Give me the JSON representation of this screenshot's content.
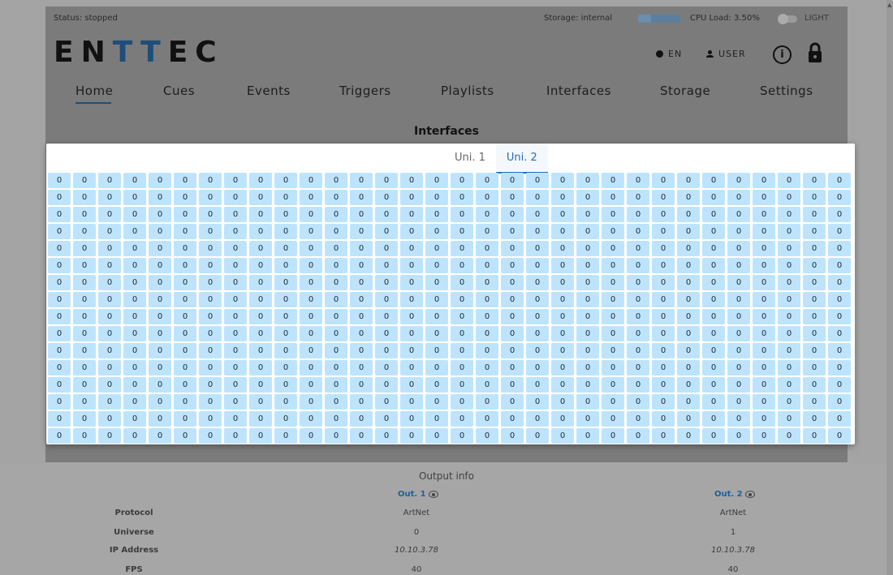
{
  "status": {
    "text": "Status: stopped"
  },
  "storage": {
    "label": "Storage: internal",
    "fill_fraction": 0.3
  },
  "cpu": {
    "label": "CPU Load: 3.50%"
  },
  "theme": {
    "label": "LIGHT"
  },
  "logo": {
    "part1": "EN",
    "part2": "TT",
    "part3": "EC"
  },
  "header": {
    "language": "EN",
    "user": "USER"
  },
  "nav": {
    "items": [
      {
        "label": "Home"
      },
      {
        "label": "Cues"
      },
      {
        "label": "Events"
      },
      {
        "label": "Triggers"
      },
      {
        "label": "Playlists"
      },
      {
        "label": "Interfaces"
      },
      {
        "label": "Storage"
      },
      {
        "label": "Settings"
      }
    ],
    "active": "Home"
  },
  "page": {
    "title": "Interfaces"
  },
  "modal": {
    "tabs": [
      {
        "label": "Uni. 1"
      },
      {
        "label": "Uni. 2"
      }
    ],
    "active_tab": "Uni. 2",
    "grid": {
      "rows": 16,
      "columns": 32,
      "value": "0"
    }
  },
  "output_info": {
    "title": "Output info",
    "outputs": [
      {
        "label": "Out. 1",
        "protocol": "ArtNet",
        "universe": "0",
        "ip": "10.10.3.78",
        "fps": "40"
      },
      {
        "label": "Out. 2",
        "protocol": "ArtNet",
        "universe": "1",
        "ip": "10.10.3.78",
        "fps": "40"
      }
    ],
    "row_labels": {
      "protocol": "Protocol",
      "universe": "Universe",
      "ip": "IP Address",
      "fps": "FPS"
    }
  },
  "colors": {
    "accent": "#1e4e79",
    "tab_active": "#2b6cb0",
    "cell_bg": "#bde4fc"
  }
}
